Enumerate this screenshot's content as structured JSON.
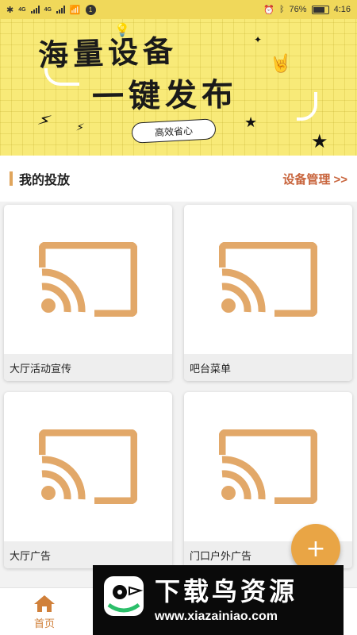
{
  "status_bar": {
    "network1": "4G",
    "network2": "4G",
    "notification_count": "1",
    "battery": "76%",
    "time": "4:16"
  },
  "banner": {
    "title_line1": "海量设备",
    "title_line2": "一键发布",
    "tag": "高效省心"
  },
  "section": {
    "title": "我的投放",
    "manage_link": "设备管理 >>"
  },
  "cards": [
    {
      "label": "大厅活动宣传",
      "icon": "cast-icon"
    },
    {
      "label": "吧台菜单",
      "icon": "cast-icon"
    },
    {
      "label": "大厅广告",
      "icon": "cast-icon"
    },
    {
      "label": "门口户外广告",
      "icon": "cast-icon"
    }
  ],
  "fab": {
    "label": "+"
  },
  "bottom_nav": {
    "home_label": "首页",
    "home_icon": "home-icon"
  },
  "watermark": {
    "title": "下载鸟资源",
    "url": "www.xiazainiao.com"
  },
  "colors": {
    "accent": "#e0a55c",
    "link": "#c8643c",
    "fab": "#e9a545",
    "banner_bg": "#f8ea78",
    "cast_icon": "#e2a869"
  }
}
